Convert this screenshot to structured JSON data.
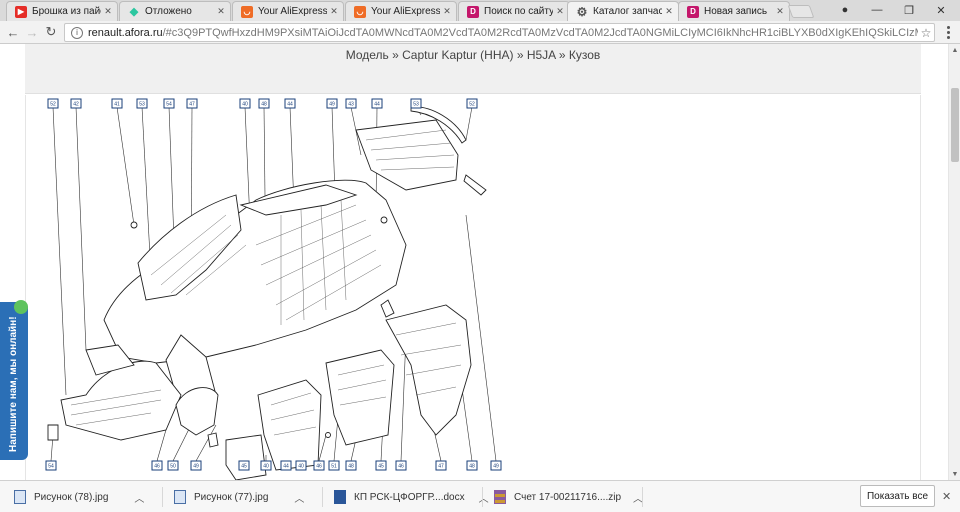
{
  "tabs": [
    {
      "title": "Брошка из пайетс",
      "icon": "youtube-icon",
      "active": false
    },
    {
      "title": "Отложено",
      "icon": "gem-icon",
      "active": false
    },
    {
      "title": "Your AliExpress sh",
      "icon": "aliexpress-icon",
      "active": false
    },
    {
      "title": "Your AliExpress sh",
      "icon": "aliexpress-icon",
      "active": false
    },
    {
      "title": "Поиск по сайту",
      "icon": "d-icon",
      "active": false
    },
    {
      "title": "Каталог запчасте",
      "icon": "gear-icon",
      "active": true
    },
    {
      "title": "Новая запись",
      "icon": "d-icon",
      "active": false
    }
  ],
  "address": {
    "host": "renault.afora.ru",
    "path": "/#c3Q9PTQwfHxzdHM9PXsiMTAiOiJcdTA0MWNcdTA0M2VcdTA0M2RcdTA0MzVcdTA0M2JcdTA0NGMiLCIyMCI6IkNhcHR1ciBLYXB0dXIgKEhIQSkiLCIzMCI6Ikg1SkEiLCI0MCI6IlxI..."
  },
  "page": {
    "breadcrumb": "Модель » Captur Kaptur (HHA) » H5JA » Кузов"
  },
  "diagram": {
    "top_callouts": [
      "52",
      "42",
      "41",
      "53",
      "54",
      "47",
      "40",
      "48",
      "44",
      "49",
      "43",
      "44",
      "53",
      "52"
    ],
    "bottom_callouts": [
      "54",
      "46",
      "50",
      "49",
      "45",
      "40",
      "44",
      "40",
      "46",
      "51",
      "48",
      "45",
      "46",
      "47",
      "48",
      "49",
      "40",
      "48"
    ]
  },
  "chat_widget": {
    "label": "Напишите нам, мы онлайн!"
  },
  "downloads": [
    {
      "name": "Рисунок (78).jpg",
      "type": "image"
    },
    {
      "name": "Рисунок (77).jpg",
      "type": "image"
    },
    {
      "name": "КП РСК-ЦФОРГР....docx",
      "type": "doc"
    },
    {
      "name": "Счет 17-00211716....zip",
      "type": "zip"
    }
  ],
  "download_show_all": "Показать все",
  "colors": {
    "callout_border": "#1a3f7a",
    "chat_bg": "#2b6fb6",
    "chat_dot": "#5ec35e"
  }
}
